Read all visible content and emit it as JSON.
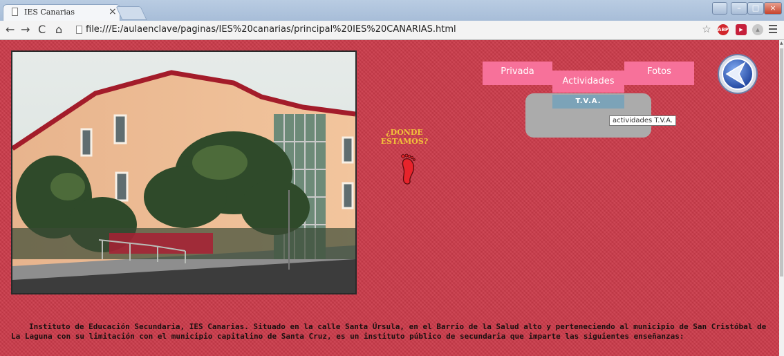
{
  "browser": {
    "tab_title": "IES Canarias",
    "tab_close": "×",
    "url": "file:///E:/aulaenclave/paginas/IES%20canarias/principal%20IES%20CANARIAS.html",
    "abp_label": "ABP"
  },
  "page": {
    "menu": {
      "privada": "Privada",
      "actividades": "Actividades",
      "fotos": "Fotos"
    },
    "dropdown_item": "T.V.A.",
    "tooltip": "actividades T.V.A.",
    "location_title_line1": "¿DONDE",
    "location_title_line2": "ESTAMOS?",
    "description": "Instituto de Educación Secundaria, IES Canarias. Situado en la calle Santa Úrsula, en el Barrio de la Salud alto y perteneciendo al municipio de San Cristóbal de La Laguna con su limitación con el municipio capitalino de Santa Cruz, es un instituto público de secundaria que imparte las siguientes enseñanzas:"
  },
  "icons": [
    "page-icon",
    "back-arrow-icon",
    "forward-arrow-icon",
    "reload-icon",
    "home-icon",
    "star-icon",
    "adblock-icon",
    "footprint-icon",
    "back-circle-icon",
    "menu-icon"
  ],
  "colors": {
    "page_background": "#cb3b4a",
    "menu_pink": "#f7719a",
    "dropdown_gray": "#ababab",
    "dropdown_item_blue": "#7ca3b8",
    "location_text": "#f2c23a"
  }
}
